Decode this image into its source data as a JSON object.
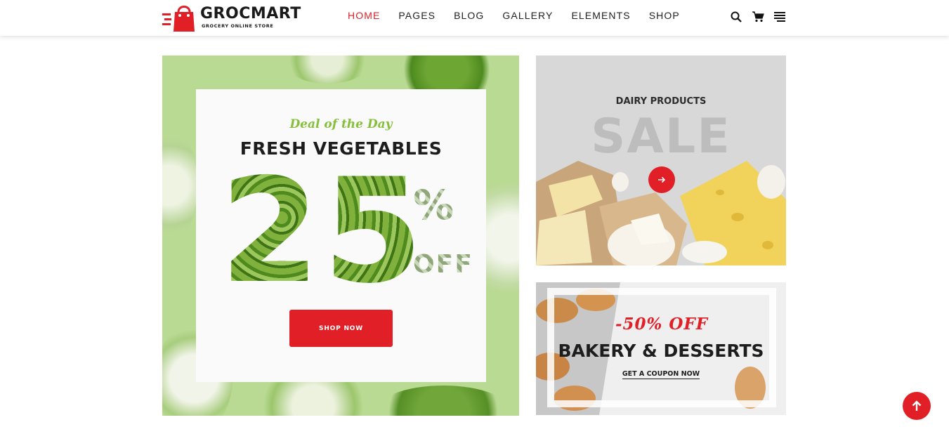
{
  "brand": {
    "name": "GROCMART",
    "tagline": "GROCERY ONLINE STORE",
    "accent": "#e11f26"
  },
  "nav": {
    "items": [
      {
        "label": "HOME",
        "active": true
      },
      {
        "label": "PAGES",
        "active": false
      },
      {
        "label": "BLOG",
        "active": false
      },
      {
        "label": "GALLERY",
        "active": false
      },
      {
        "label": "ELEMENTS",
        "active": false
      },
      {
        "label": "SHOP",
        "active": false
      }
    ]
  },
  "tools": {
    "icons": [
      "search-icon",
      "cart-icon",
      "menu-icon"
    ]
  },
  "promo_main": {
    "kicker": "Deal of the Day",
    "title": "FRESH VEGETABLES",
    "discount_number": "25",
    "percent_sign": "%",
    "off_label": "OFF",
    "button_label": "SHOP NOW"
  },
  "promo_dairy": {
    "title": "DAIRY PRODUCTS",
    "big_word": "SALE"
  },
  "promo_bakery": {
    "discount": "-50% OFF",
    "title": "BAKERY & DESSERTS",
    "link_label": "GET A COUPON NOW"
  }
}
